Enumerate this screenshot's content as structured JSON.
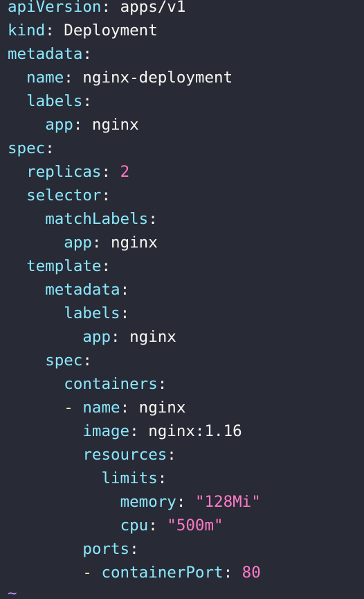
{
  "editor": {
    "lines": [
      {
        "indent": "",
        "dash": "",
        "key": "apiVersion",
        "value": "apps/v1",
        "value_type": "plain"
      },
      {
        "indent": "",
        "dash": "",
        "key": "kind",
        "value": "Deployment",
        "value_type": "plain"
      },
      {
        "indent": "",
        "dash": "",
        "key": "metadata",
        "value": "",
        "value_type": "plain"
      },
      {
        "indent": "  ",
        "dash": "",
        "key": "name",
        "value": "nginx-deployment",
        "value_type": "plain"
      },
      {
        "indent": "  ",
        "dash": "",
        "key": "labels",
        "value": "",
        "value_type": "plain"
      },
      {
        "indent": "    ",
        "dash": "",
        "key": "app",
        "value": "nginx",
        "value_type": "plain"
      },
      {
        "indent": "",
        "dash": "",
        "key": "spec",
        "value": "",
        "value_type": "plain"
      },
      {
        "indent": "  ",
        "dash": "",
        "key": "replicas",
        "value": "2",
        "value_type": "number"
      },
      {
        "indent": "  ",
        "dash": "",
        "key": "selector",
        "value": "",
        "value_type": "plain"
      },
      {
        "indent": "    ",
        "dash": "",
        "key": "matchLabels",
        "value": "",
        "value_type": "plain"
      },
      {
        "indent": "      ",
        "dash": "",
        "key": "app",
        "value": "nginx",
        "value_type": "plain"
      },
      {
        "indent": "  ",
        "dash": "",
        "key": "template",
        "value": "",
        "value_type": "plain"
      },
      {
        "indent": "    ",
        "dash": "",
        "key": "metadata",
        "value": "",
        "value_type": "plain"
      },
      {
        "indent": "      ",
        "dash": "",
        "key": "labels",
        "value": "",
        "value_type": "plain"
      },
      {
        "indent": "        ",
        "dash": "",
        "key": "app",
        "value": "nginx",
        "value_type": "plain"
      },
      {
        "indent": "    ",
        "dash": "",
        "key": "spec",
        "value": "",
        "value_type": "plain"
      },
      {
        "indent": "      ",
        "dash": "",
        "key": "containers",
        "value": "",
        "value_type": "plain"
      },
      {
        "indent": "      ",
        "dash": "- ",
        "key": "name",
        "value": "nginx",
        "value_type": "plain"
      },
      {
        "indent": "        ",
        "dash": "",
        "key": "image",
        "value": "nginx:1.16",
        "value_type": "plain"
      },
      {
        "indent": "        ",
        "dash": "",
        "key": "resources",
        "value": "",
        "value_type": "plain"
      },
      {
        "indent": "          ",
        "dash": "",
        "key": "limits",
        "value": "",
        "value_type": "plain"
      },
      {
        "indent": "            ",
        "dash": "",
        "key": "memory",
        "value": "\"128Mi\"",
        "value_type": "string"
      },
      {
        "indent": "            ",
        "dash": "",
        "key": "cpu",
        "value": "\"500m\"",
        "value_type": "string"
      },
      {
        "indent": "        ",
        "dash": "",
        "key": "ports",
        "value": "",
        "value_type": "plain"
      },
      {
        "indent": "        ",
        "dash": "- ",
        "key": "containerPort",
        "value": "80",
        "value_type": "number"
      }
    ],
    "empty_line_marker": "~"
  },
  "colors": {
    "background": "#282a36",
    "key": "#8be9fd",
    "text": "#f8f8f2",
    "number_string": "#ff79c6",
    "dash": "#f1fa8c",
    "tilde": "#bd93f9"
  }
}
